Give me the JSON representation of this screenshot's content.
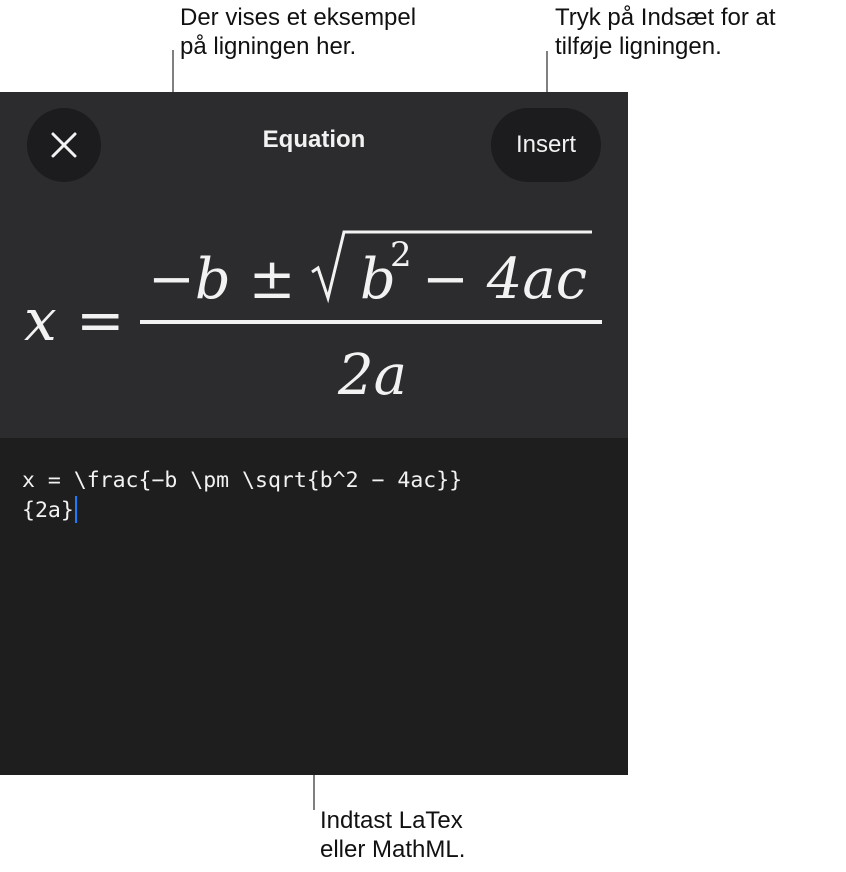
{
  "callouts": {
    "preview": "Der vises et eksempel\npå ligningen her.",
    "insert": "Tryk på Indsæt for at\ntilføje ligningen.",
    "latex": "Indtast LaTex\neller MathML."
  },
  "sheet": {
    "title": "Equation",
    "close_icon": "close-icon",
    "insert_label": "Insert"
  },
  "formula_preview": {
    "lhs": "x",
    "equals": "=",
    "numerator_prefix": "−b ±",
    "radicand_base": "b",
    "radicand_exponent": "2",
    "radicand_rest": "− 4ac",
    "denominator": "2a"
  },
  "editor": {
    "latex_text": "x = \\frac{−b \\pm \\sqrt{b^2 − 4ac}}\n{2a}",
    "cursor_color": "#1a7cff"
  },
  "colors": {
    "sheet_background": "#1e1e1f",
    "preview_background": "#2c2c2e",
    "button_background": "#1c1c1e",
    "text_light": "#f2f2f2"
  }
}
